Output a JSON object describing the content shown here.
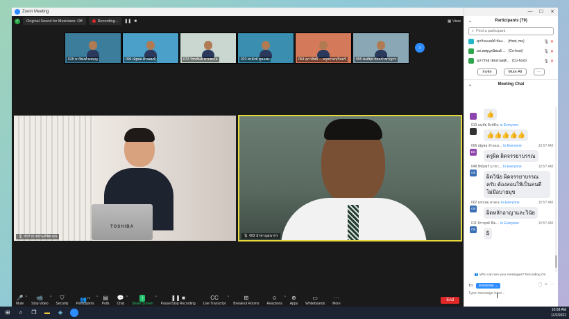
{
  "window": {
    "title": "Zoom Meeting",
    "min": "—",
    "max": "☐",
    "close": "✕"
  },
  "topbar": {
    "original_sound": "Original Sound for Musicians: Off",
    "recording": "Recording...",
    "pause": "❚❚",
    "stop": "■",
    "view": "View"
  },
  "thumbnails": [
    {
      "name": "028 นาจิพงศ์ ผลบุญ",
      "bg": "#3c7d9c"
    },
    {
      "name": "006 ณัฐพล ฮำจอมปุ์",
      "bg": "#4aa0c8"
    },
    {
      "name": "073 วัชรพันธ์ ทาเชยโจ",
      "bg": "#c9d7d0"
    },
    {
      "name": "023 ศรสังข์ ทูมแพง",
      "bg": "#3a8fb0"
    },
    {
      "name": "054 สุภาสิทธิ์ ... ครูพรรคบุรินทร์",
      "bg": "#d47a5a"
    },
    {
      "name": "055 พงศ์ยุท ชัยแก้วชาญกร",
      "bg": "#8aa7b5"
    }
  ],
  "videos": {
    "left_name": "ชำรำกายประดัชิตวอน",
    "right_name": "002 มำคาญธนากร",
    "laptop_brand": "TOSHIBA"
  },
  "toolbar": {
    "mute": "Mute",
    "stop_video": "Stop Video",
    "security": "Security",
    "participants": "Participants",
    "participants_count": "79",
    "polls": "Polls",
    "chat": "Chat",
    "share_screen": "Share Screen",
    "pause_stop_recording": "Pause/Stop Recording",
    "live_transcript": "Live Transcript",
    "breakout_rooms": "Breakout Rooms",
    "reactions": "Reactions",
    "apps": "Apps",
    "whiteboards": "Whiteboards",
    "more": "More",
    "end": "End"
  },
  "participants_panel": {
    "title": "Participants (79)",
    "search_placeholder": "Find a participant",
    "rows": [
      {
        "name": "ศุภถิรเคลน์ท์ ห้อง...",
        "role": "(Host, me)",
        "color": "#26b5c5"
      },
      {
        "name": "ผส.สพฐมูลนิพนธ์ ...",
        "role": "(Co-host)",
        "color": "#2ea44f"
      },
      {
        "name": "มหาวิทยาลัยสวนดุสิ...",
        "role": "(Co-host)",
        "color": "#2ea44f"
      }
    ],
    "invite": "Invite",
    "mute_all": "Mute All",
    "more": "···"
  },
  "chat_panel": {
    "title": "Meeting Chat",
    "messages": [
      {
        "sender": "",
        "to": "",
        "time": "",
        "text": "👍",
        "avatar": "",
        "color": "#8e44ad",
        "type": "emoji"
      },
      {
        "sender": "013 อนุชัย สิงห์ทิน",
        "to": "to Everyone",
        "time": "",
        "text": "👍👍👍👍👍",
        "avatar": "",
        "color": "#333",
        "type": "emoji"
      },
      {
        "sender": "006 ณัฐพล ฮำจอม...",
        "to": "to Everyone",
        "time": "10:57 AM",
        "text": "ครูผิด ผิดจรรยาบรรณ",
        "avatar": "Div",
        "color": "#8e44ad",
        "type": "text"
      },
      {
        "sender": "048 ทิฆัมพร์ มาชา...",
        "to": "to Everyone",
        "time": "10:57 AM",
        "text": "ผิดวินัย ผิดจรรยาบรรณครับ ต้องสอนให้เป็นคนดีไม่มีอบายมุข",
        "avatar": "Ok",
        "color": "#3b6fb6",
        "type": "text"
      },
      {
        "sender": "002 มหกลม สาดเจ",
        "to": "to Everyone",
        "time": "10:57 AM",
        "text": "ผิดหลักอาญาและวินัย",
        "avatar": "Ok",
        "color": "#3b6fb6",
        "type": "text"
      },
      {
        "sender": "011 จิรายุทธ์ พึ่งเ...",
        "to": "to Everyone",
        "time": "10:57 AM",
        "text": "ผิ",
        "avatar": "Ok",
        "color": "#3b6fb6",
        "type": "text"
      }
    ],
    "who_can_see": "Who can see your messages? Recording On",
    "to_label": "To:",
    "to_everyone": "Everyone ⌄",
    "input_placeholder": "Type message here..."
  },
  "taskbar": {
    "time": "10:58 AM",
    "date": "11/2/2022"
  }
}
